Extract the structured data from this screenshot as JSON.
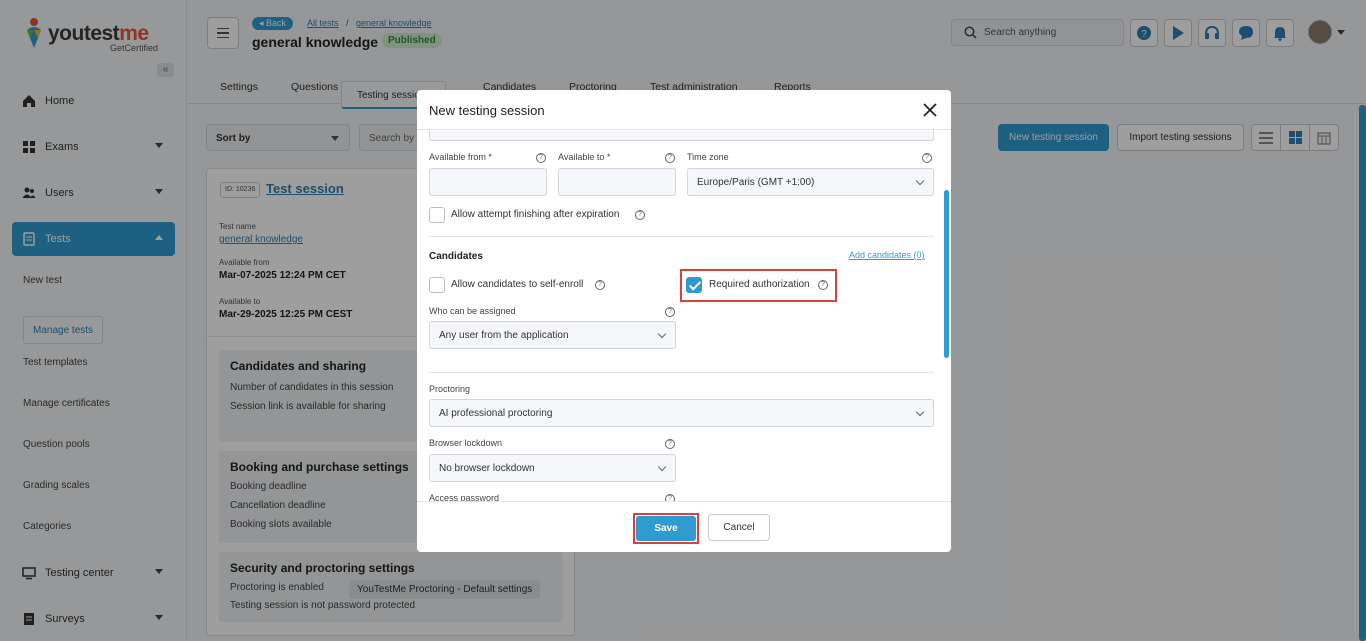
{
  "brand": {
    "name_a": "youtest",
    "name_b": "me",
    "tagline": "GetCertified"
  },
  "sidebar": {
    "items": [
      {
        "label": "Home",
        "icon": "home-icon"
      },
      {
        "label": "Exams",
        "icon": "exams-icon"
      },
      {
        "label": "Users",
        "icon": "users-icon"
      },
      {
        "label": "Tests",
        "icon": "tests-icon"
      },
      {
        "label": "Testing center",
        "icon": "testing-center-icon"
      },
      {
        "label": "Surveys",
        "icon": "surveys-icon"
      }
    ],
    "subitems": [
      "New test",
      "Manage tests",
      "Test templates",
      "Manage certificates",
      "Question pools",
      "Grading scales",
      "Categories"
    ]
  },
  "header": {
    "back_label": "Back",
    "breadcrumb": [
      "All tests",
      "general knowledge"
    ],
    "breadcrumb_sep": "/",
    "title": "general knowledge",
    "status": "Published",
    "search_placeholder": "Search anything"
  },
  "tabs": [
    "Settings",
    "Questions",
    "Testing sessions",
    "Candidates",
    "Proctoring",
    "Test administration",
    "Reports"
  ],
  "toolbar": {
    "sort_label": "Sort by",
    "search_label": "Search by t",
    "new_session": "New testing session",
    "import_sessions": "Import testing sessions"
  },
  "card": {
    "id": "ID: 10236",
    "title": "Test session",
    "test_name_label": "Test name",
    "test_name": "general knowledge",
    "available_from_label": "Available from",
    "available_from": "Mar-07-2025 12:24 PM CET",
    "available_to_label": "Available to",
    "available_to": "Mar-29-2025 12:25 PM CEST",
    "panels": [
      {
        "title": "Candidates and sharing",
        "lines": [
          "Number of candidates in this session",
          "Session link is available for sharing"
        ]
      },
      {
        "title": "Booking and purchase settings",
        "lines": [
          "Booking deadline",
          "Cancellation deadline",
          "Booking slots available"
        ]
      },
      {
        "title": "Security and proctoring settings",
        "lines": [
          "Proctoring is enabled",
          "Testing session is not password protected"
        ],
        "chip": "YouTestMe Proctoring - Default settings"
      }
    ]
  },
  "modal": {
    "title": "New testing session",
    "available_from_label": "Available from *",
    "available_to_label": "Available to *",
    "timezone_label": "Time zone",
    "timezone_value": "Europe/Paris (GMT +1:00)",
    "allow_finish_label": "Allow attempt finishing after expiration",
    "candidates_title": "Candidates",
    "add_candidates": "Add candidates (0)",
    "self_enroll_label": "Allow candidates to self-enroll",
    "required_auth_label": "Required authorization",
    "required_auth_checked": true,
    "who_assigned_label": "Who can be assigned",
    "who_assigned_value": "Any user from the application",
    "proctoring_label": "Proctoring",
    "proctoring_value": "AI professional proctoring",
    "lockdown_label": "Browser lockdown",
    "lockdown_value": "No browser lockdown",
    "access_password_label": "Access password",
    "help_glyph": "?",
    "save": "Save",
    "cancel": "Cancel"
  },
  "colors": {
    "accent": "#2f9bd1",
    "highlight": "#d9413f",
    "published_bg": "#cfeccf"
  }
}
